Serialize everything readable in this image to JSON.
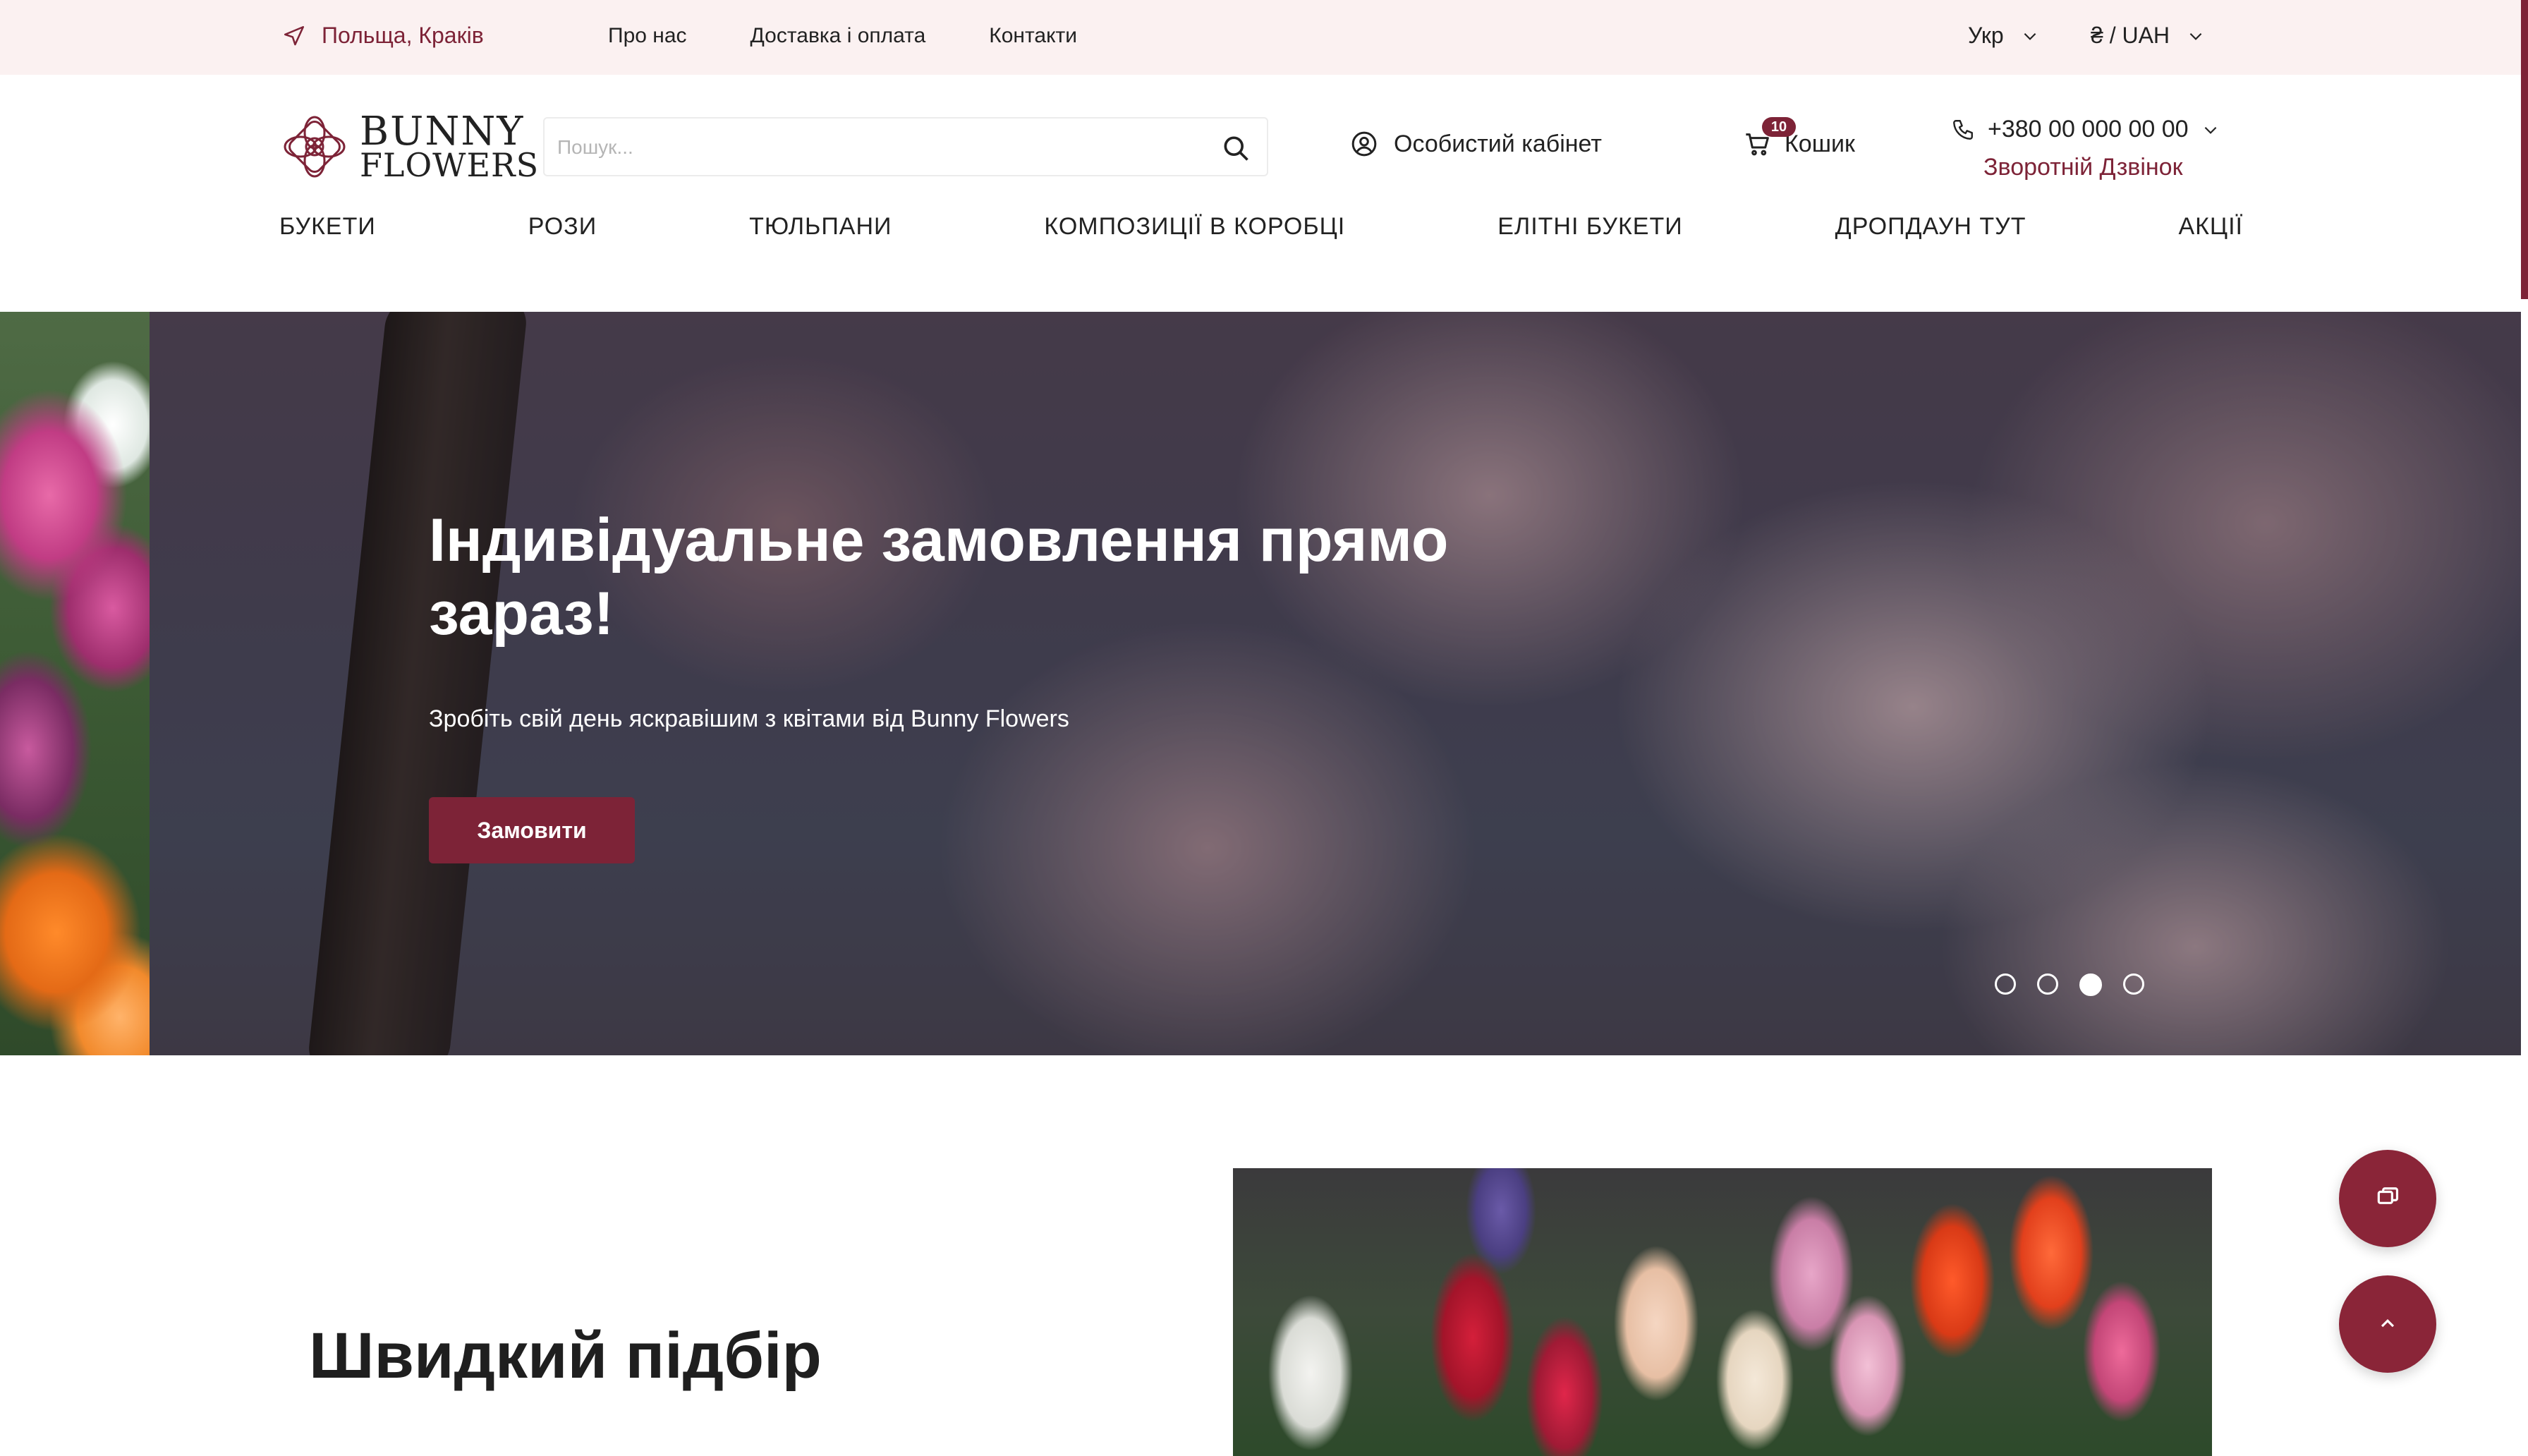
{
  "topbar": {
    "location": "Польща, Краків",
    "links": [
      "Про нас",
      "Доставка і оплата",
      "Контакти"
    ],
    "language": "Укр",
    "currency": "₴ / UAH"
  },
  "header": {
    "logo_line1": "BUNNY",
    "logo_line2": "FLOWERS",
    "search_placeholder": "Пошук...",
    "account_label": "Особистий кабінет",
    "cart_label": "Кошик",
    "cart_count": "10",
    "phone": "+380 00 000 00 00",
    "callback_label": "Зворотній Дзвінок"
  },
  "nav": {
    "items": [
      "БУКЕТИ",
      "РОЗИ",
      "ТЮЛЬПАНИ",
      "КОМПОЗИЦІЇ В КОРОБЦІ",
      "ЕЛІТНІ БУКЕТИ",
      "ДРОПДАУН ТУТ",
      "АКЦІЇ"
    ]
  },
  "hero": {
    "title": "Індивідуальне замовлення прямо зараз!",
    "subtitle": "Зробіть свій день яскравішим з квітами від Bunny Flowers",
    "button_label": "Замовити",
    "slides_total": 4,
    "active_slide": 3
  },
  "quick_pick": {
    "title": "Швидкий підбір"
  },
  "colors": {
    "brand": "#7d2337",
    "topbar_bg": "#fbf1f1"
  },
  "icons": {
    "location": "location-arrow-icon",
    "search": "search-icon",
    "account": "user-circle-icon",
    "cart": "cart-icon",
    "phone": "phone-icon",
    "chat": "chat-icon",
    "scroll_up": "chevron-up-icon"
  }
}
